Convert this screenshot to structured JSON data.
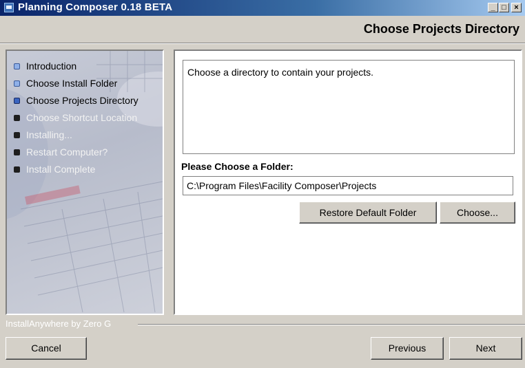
{
  "window": {
    "title": "Planning Composer 0.18 BETA",
    "controls": {
      "minimize": "_",
      "maximize": "□",
      "close": "×"
    }
  },
  "header": {
    "title": "Choose Projects Directory"
  },
  "steps": [
    {
      "label": "Introduction",
      "state": "done"
    },
    {
      "label": "Choose Install Folder",
      "state": "done"
    },
    {
      "label": "Choose Projects Directory",
      "state": "current"
    },
    {
      "label": "Choose Shortcut Location",
      "state": "future"
    },
    {
      "label": "Installing...",
      "state": "future"
    },
    {
      "label": "Restart Computer?",
      "state": "future"
    },
    {
      "label": "Install Complete",
      "state": "future"
    }
  ],
  "content": {
    "message": "Choose a directory to contain your projects.",
    "folder_label": "Please Choose a Folder:",
    "folder_path": "C:\\Program Files\\Facility Composer\\Projects",
    "restore_button": "Restore Default Folder",
    "choose_button": "Choose..."
  },
  "footer": {
    "brand": "InstallAnywhere by Zero G",
    "cancel": "Cancel",
    "previous": "Previous",
    "next": "Next"
  },
  "colors": {
    "title_bar": "#0a246a",
    "window_bg": "#d4d0c8",
    "current_step_bullet": "#3a64c0"
  }
}
